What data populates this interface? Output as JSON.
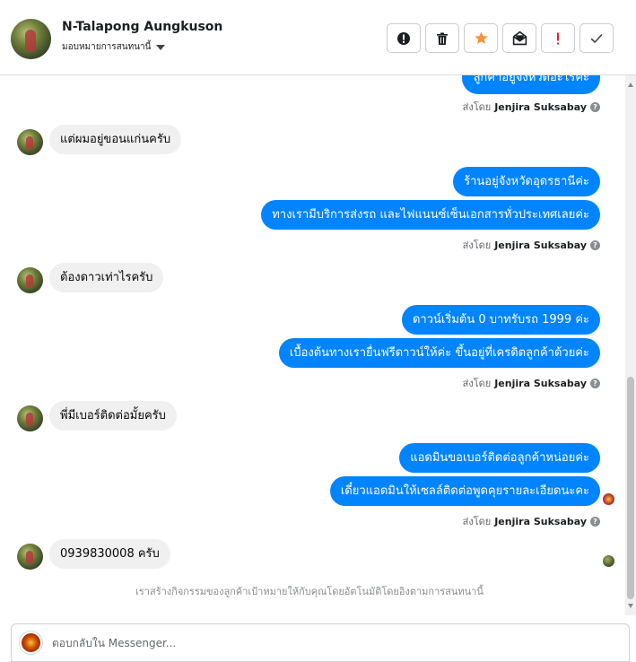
{
  "header": {
    "contact_name": "N-Talapong Aungkuson",
    "assign_label": "มอบหมายการสนทนานี้",
    "actions": [
      {
        "name": "spam-button",
        "icon": "alert-circle-icon"
      },
      {
        "name": "delete-button",
        "icon": "trash-icon"
      },
      {
        "name": "star-button",
        "icon": "star-icon",
        "color": "#f7923a"
      },
      {
        "name": "mark-unread-button",
        "icon": "envelope-open-icon"
      },
      {
        "name": "follow-up-button",
        "icon": "exclamation-icon",
        "color": "#e41e3f"
      },
      {
        "name": "mark-done-button",
        "icon": "checkmark-icon"
      }
    ]
  },
  "messages": [
    {
      "kind": "out",
      "text": "ลูกค้าอยู่จังหวัดอะไรคะ"
    },
    {
      "kind": "sender",
      "prefix": "ส่งโดย",
      "name": "Jenjira Suksabay"
    },
    {
      "kind": "in",
      "text": "แต่ผมอยู่ขอนแก่นครับ"
    },
    {
      "kind": "out",
      "text": "ร้านอยู่จังหวัดอุดรธานีค่ะ"
    },
    {
      "kind": "out",
      "text": "ทางเรามีบริการส่งรถ และไฟแนนซ์เซ็นเอกสารทั่วประเทศเลยค่ะ"
    },
    {
      "kind": "sender",
      "prefix": "ส่งโดย",
      "name": "Jenjira Suksabay"
    },
    {
      "kind": "in",
      "text": "ต้องดาวเท่าไรครับ"
    },
    {
      "kind": "out",
      "text": "ดาวน์เริ่มต้น 0 บาทรับรถ 1999 ค่ะ"
    },
    {
      "kind": "out",
      "text": "เบื้องต้นทางเรายื่นฟรีดาวน์ให้ค่ะ ขึ้นอยู่ที่เครดิตลูกค้าด้วยค่ะ"
    },
    {
      "kind": "sender",
      "prefix": "ส่งโดย",
      "name": "Jenjira Suksabay"
    },
    {
      "kind": "in",
      "text": "พี่มีเบอร์ติดต่อมั้ยครับ"
    },
    {
      "kind": "out",
      "text": "แอดมินขอเบอร์ติดต่อลูกค้าหน่อยค่ะ"
    },
    {
      "kind": "out",
      "text": "เดี๋ยวแอดมินให้เซลล์ติดต่อพูดคุยรายละเอียดนะคะ"
    },
    {
      "kind": "sender",
      "prefix": "ส่งโดย",
      "name": "Jenjira Suksabay"
    },
    {
      "kind": "in",
      "text": "0939830008 ครับ"
    }
  ],
  "footnote": "เราสร้างกิจกรรมของลูกค้าเป้าหมายให้กับคุณโดยอัตโนมัติโดยอิงตามการสนทนานี้",
  "composer": {
    "placeholder": "ตอบกลับใน Messenger...",
    "value": ""
  },
  "colors": {
    "outgoing_bubble": "#0084ff",
    "incoming_bubble": "#f0f0f0",
    "star": "#f7923a",
    "alert": "#e41e3f"
  }
}
